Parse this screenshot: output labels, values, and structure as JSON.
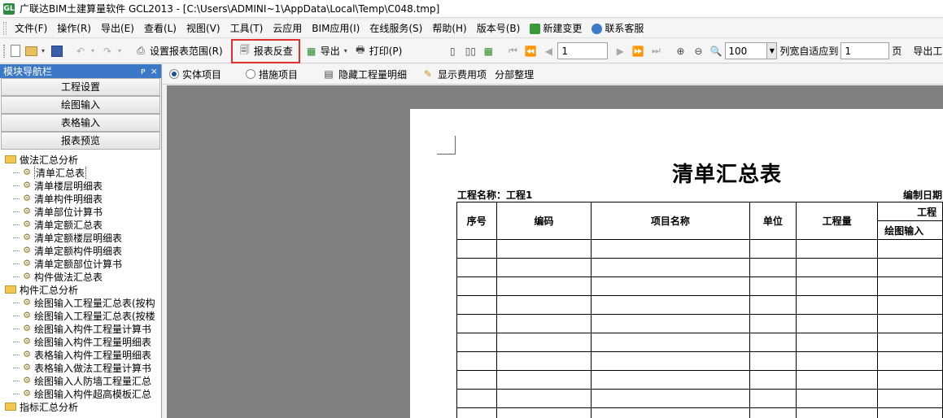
{
  "window": {
    "app_icon": "GL",
    "title": "广联达BIM土建算量软件 GCL2013 - [C:\\Users\\ADMINI~1\\AppData\\Local\\Temp\\C048.tmp]"
  },
  "menu": {
    "items": [
      "文件(F)",
      "操作(R)",
      "导出(E)",
      "查看(L)",
      "视图(V)",
      "工具(T)",
      "云应用",
      "BIM应用(I)",
      "在线服务(S)",
      "帮助(H)",
      "版本号(B)"
    ],
    "new_change": "新建变更",
    "contact": "联系客服"
  },
  "toolbar": {
    "set_range": "设置报表范围(R)",
    "report_lookup": "报表反查",
    "export": "导出",
    "print": "打印(P)",
    "page_value": "1",
    "zoom_value": "100",
    "fit_label": "列宽自适应到",
    "fit_value": "1",
    "page_unit": "页",
    "export_project": "导出工程"
  },
  "nav": {
    "header": "模块导航栏",
    "pin": "ᴘ",
    "close": "×",
    "sections": [
      "工程设置",
      "绘图输入",
      "表格输入",
      "报表预览"
    ],
    "groups": [
      {
        "label": "做法汇总分析",
        "items": [
          "清单汇总表",
          "清单楼层明细表",
          "清单构件明细表",
          "清单部位计算书",
          "清单定额汇总表",
          "清单定额楼层明细表",
          "清单定额构件明细表",
          "清单定额部位计算书",
          "构件做法汇总表"
        ]
      },
      {
        "label": "构件汇总分析",
        "items": [
          "绘图输入工程量汇总表(按构",
          "绘图输入工程量汇总表(按楼",
          "绘图输入构件工程量计算书",
          "绘图输入构件工程量明细表",
          "表格输入构件工程量明细表",
          "表格输入做法工程量计算书",
          "绘图输入人防墙工程量汇总",
          "绘图输入构件超高模板汇总"
        ]
      },
      {
        "label": "指标汇总分析",
        "items": []
      }
    ]
  },
  "subbar": {
    "radio_entity": "实体项目",
    "radio_measure": "措施项目",
    "hide_detail": "隐藏工程量明细",
    "show_cost": "显示费用项",
    "section_sort": "分部整理"
  },
  "report": {
    "title": "清单汇总表",
    "project_label": "工程名称：工程1",
    "date_label": "编制日期",
    "headers": [
      "序号",
      "编码",
      "项目名称",
      "单位",
      "工程量"
    ],
    "group_header": "工程",
    "sub_header": "绘图输入"
  },
  "colors": {
    "nav_header": "#3c78c8",
    "highlight": "#e03030",
    "canvas": "#808080"
  }
}
